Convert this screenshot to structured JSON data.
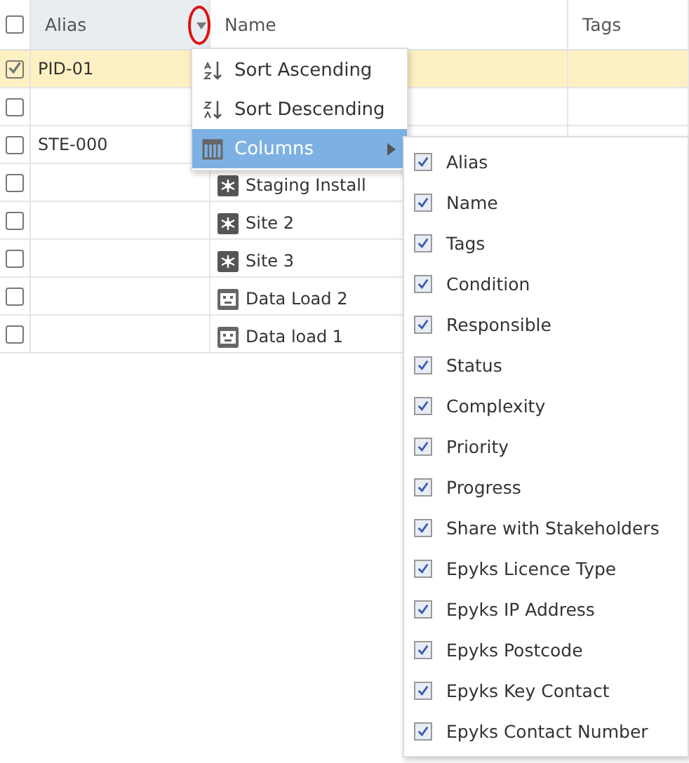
{
  "table": {
    "header_checkbox": {
      "checked": false
    },
    "columns": [
      {
        "label": "Alias",
        "active": true
      },
      {
        "label": "Name",
        "active": false
      },
      {
        "label": "Tags",
        "active": false
      }
    ],
    "rows": [
      {
        "checked": true,
        "selected": true,
        "alias": "PID-01"
      },
      {
        "checked": false,
        "selected": false
      },
      {
        "checked": false,
        "selected": false,
        "alias": "STE-000"
      },
      {
        "checked": false,
        "selected": false,
        "name": "Staging Install",
        "kind": "site"
      },
      {
        "checked": false,
        "selected": false,
        "name": "Site 2",
        "kind": "site"
      },
      {
        "checked": false,
        "selected": false,
        "name": "Site 3",
        "kind": "site"
      },
      {
        "checked": false,
        "selected": false,
        "name": "Data Load 2",
        "kind": "data"
      },
      {
        "checked": false,
        "selected": false,
        "name": "Data load 1",
        "kind": "data"
      }
    ]
  },
  "column_menu": {
    "items": [
      {
        "kind": "sort-asc",
        "label": "Sort Ascending",
        "selected": false
      },
      {
        "kind": "sort-desc",
        "label": "Sort Descending",
        "selected": false
      },
      {
        "kind": "columns",
        "label": "Columns",
        "selected": true
      }
    ]
  },
  "columns_submenu": {
    "items": [
      {
        "label": "Alias",
        "checked": true
      },
      {
        "label": "Name",
        "checked": true
      },
      {
        "label": "Tags",
        "checked": true
      },
      {
        "label": "Condition",
        "checked": true
      },
      {
        "label": "Responsible",
        "checked": true
      },
      {
        "label": "Status",
        "checked": true
      },
      {
        "label": "Complexity",
        "checked": true
      },
      {
        "label": "Priority",
        "checked": true
      },
      {
        "label": "Progress",
        "checked": true
      },
      {
        "label": "Share with Stakeholders",
        "checked": true
      },
      {
        "label": "Epyks Licence Type",
        "checked": true
      },
      {
        "label": "Epyks IP Address",
        "checked": true
      },
      {
        "label": "Epyks Postcode",
        "checked": true
      },
      {
        "label": "Epyks Key Contact",
        "checked": true
      },
      {
        "label": "Epyks Contact Number",
        "checked": true
      }
    ]
  }
}
